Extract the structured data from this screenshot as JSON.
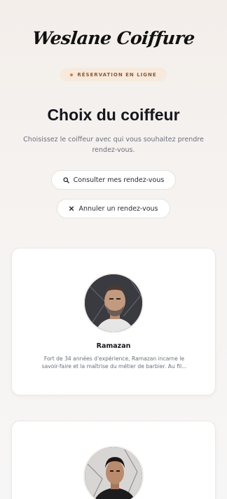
{
  "header": {
    "brand": "Weslane Coiffure",
    "badge": "RÉSERVATION EN LIGNE",
    "title": "Choix du coiffeur",
    "subtitle": "Choisissez le coiffeur avec qui vous souhaitez prendre rendez-vous."
  },
  "actions": {
    "consult_label": "Consulter mes rendez-vous",
    "cancel_label": "Annuler un rendez-vous"
  },
  "barbers": [
    {
      "name": "Ramazan",
      "description": "Fort de 34 années d'expérience, Ramazan incarne le savoir-faire et la maîtrise du métier de barbier. Au fil..."
    }
  ],
  "icons": {
    "consult": "search-icon",
    "cancel": "close-icon"
  },
  "colors": {
    "accent": "#c9823e",
    "badge_bg": "#f7e9dc",
    "badge_text": "#8a5a32"
  }
}
